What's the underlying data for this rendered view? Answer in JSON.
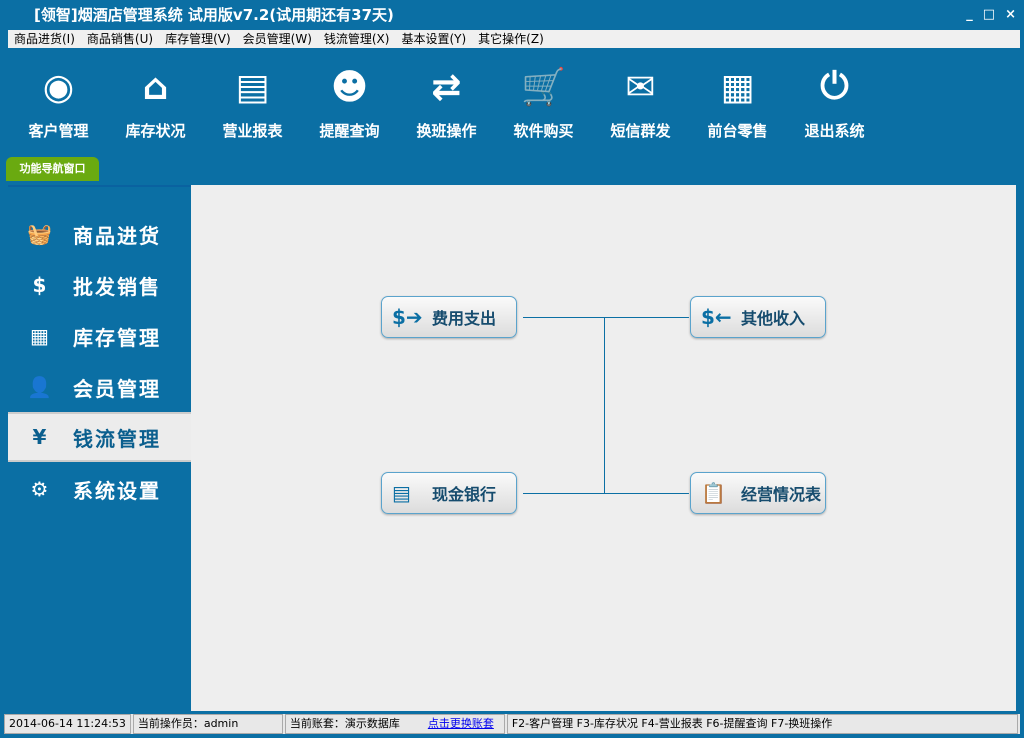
{
  "title": "[领智]烟酒店管理系统 试用版v7.2(试用期还有37天)",
  "window_controls": [
    "_",
    "□",
    "×"
  ],
  "menu": [
    "商品进货(I)",
    "商品销售(U)",
    "库存管理(V)",
    "会员管理(W)",
    "钱流管理(X)",
    "基本设置(Y)",
    "其它操作(Z)"
  ],
  "toolbar": [
    {
      "label": "客户管理",
      "icon": "user-circle-icon",
      "glyph": "◉"
    },
    {
      "label": "库存状况",
      "icon": "house-icon",
      "glyph": "⌂"
    },
    {
      "label": "营业报表",
      "icon": "notepad-icon",
      "glyph": "▤"
    },
    {
      "label": "提醒查询",
      "icon": "chat-user-icon",
      "glyph": "☻"
    },
    {
      "label": "换班操作",
      "icon": "swap-arrows-icon",
      "glyph": "⇄"
    },
    {
      "label": "软件购买",
      "icon": "cart-icon",
      "glyph": "🛒"
    },
    {
      "label": "短信群发",
      "icon": "envelope-icon",
      "glyph": "✉"
    },
    {
      "label": "前台零售",
      "icon": "cash-register-icon",
      "glyph": "▦"
    },
    {
      "label": "退出系统",
      "icon": "power-icon",
      "glyph": "⏻"
    }
  ],
  "nav_tab": "功能导航窗口",
  "sidebar": [
    {
      "label": "商品进货",
      "icon": "basket-icon",
      "glyph": "🧺"
    },
    {
      "label": "批发销售",
      "icon": "receipt-icon",
      "glyph": "$"
    },
    {
      "label": "库存管理",
      "icon": "grid-icon",
      "glyph": "▦"
    },
    {
      "label": "会员管理",
      "icon": "user-icon",
      "glyph": "👤"
    },
    {
      "label": "钱流管理",
      "icon": "yen-icon",
      "glyph": "¥"
    },
    {
      "label": "系统设置",
      "icon": "gear-icon",
      "glyph": "⚙"
    }
  ],
  "functions": [
    {
      "label": "费用支出",
      "icon": "money-out-icon",
      "glyph": "$➔"
    },
    {
      "label": "其他收入",
      "icon": "money-in-icon",
      "glyph": "$←"
    },
    {
      "label": "现金银行",
      "icon": "cash-stack-icon",
      "glyph": "▤"
    },
    {
      "label": "经营情况表",
      "icon": "clipboard-icon",
      "glyph": "📋"
    }
  ],
  "status": {
    "datetime": "2014-06-14 11:24:53",
    "operator": "当前操作员：admin",
    "account": "当前账套：演示数据库",
    "switch_link": "点击更换账套",
    "shortcuts": "F2-客户管理 F3-库存状况 F4-营业报表 F6-提醒查询 F7-换班操作"
  }
}
